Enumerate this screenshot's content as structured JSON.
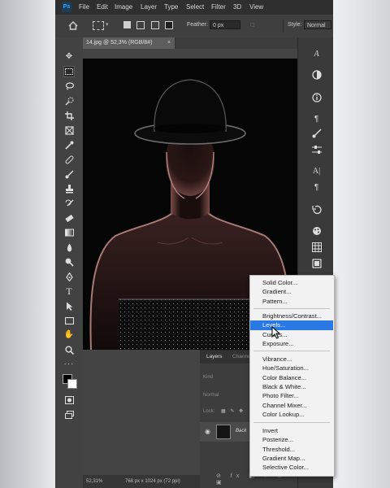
{
  "menubar": {
    "app_icon_label": "Ps",
    "items": [
      "File",
      "Edit",
      "Image",
      "Layer",
      "Type",
      "Select",
      "Filter",
      "3D",
      "View"
    ]
  },
  "options_bar": {
    "feather_label": "Feather:",
    "feather_value": "0 px",
    "style_label": "Style:",
    "style_value": "Normal"
  },
  "document": {
    "tab_title": "14.jpg @ 52,3% (RGB/8#)",
    "close_glyph": "×"
  },
  "status_bar": {
    "zoom": "52,31%",
    "dimensions": "768 px x 1024 px (72 ppi)"
  },
  "layers_panel": {
    "tabs": [
      "Layers",
      "Channe"
    ],
    "kind_label": "Kind",
    "blend_mode": "Normal",
    "lock_label": "Lock:",
    "layer_name": "Back"
  },
  "adjustment_menu": {
    "groups": [
      [
        "Solid Color...",
        "Gradient...",
        "Pattern..."
      ],
      [
        "Brightness/Contrast...",
        "Levels...",
        "Curves...",
        "Exposure..."
      ],
      [
        "Vibrance...",
        "Hue/Saturation...",
        "Color Balance...",
        "Black & White...",
        "Photo Filter...",
        "Channel Mixer...",
        "Color Lookup..."
      ],
      [
        "Invert",
        "Posterize...",
        "Threshold...",
        "Gradient Map...",
        "Selective Color..."
      ]
    ],
    "highlighted": "Levels...",
    "highlight_color": "#2a78e4"
  },
  "colors": {
    "menubar_bg": "#2f2f2f",
    "workspace_bg": "#535353",
    "menu_bg": "#f2f2f2",
    "accent": "#31a8ff"
  },
  "tools": [
    "move-icon",
    "marquee-icon",
    "lasso-icon",
    "quick-select-icon",
    "crop-icon",
    "frame-icon",
    "eyedropper-icon",
    "healing-icon",
    "brush-icon",
    "clone-stamp-icon",
    "history-brush-icon",
    "eraser-icon",
    "gradient-icon",
    "blur-icon",
    "dodge-icon",
    "pen-icon",
    "type-icon",
    "path-select-icon",
    "rectangle-icon",
    "hand-icon",
    "zoom-icon",
    "more-tools-icon"
  ]
}
